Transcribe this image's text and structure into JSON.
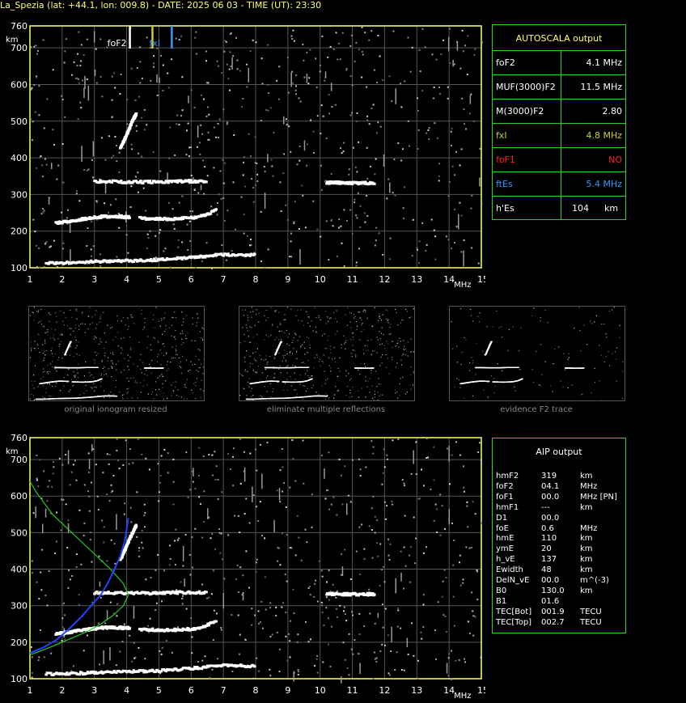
{
  "header": "La_Spezia (lat: +44.1, lon: 009.8) - DATE: 2025 06 03 - TIME (UT): 23:30",
  "colors": {
    "frame": "#ffff66",
    "grid": "#555555",
    "panel_border": "#33cc33",
    "fxI": "#cccc33",
    "foF1": "#ff2020",
    "ftEs": "#3399ff",
    "profile": "#22cc22",
    "trace": "#2244ff"
  },
  "autoscala": {
    "title": "AUTOSCALA output",
    "rows": [
      {
        "label": "foF2",
        "value": "4.1 MHz",
        "color": "#ffffff"
      },
      {
        "label": "MUF(3000)F2",
        "value": "11.5 MHz",
        "color": "#ffffff"
      },
      {
        "label": "M(3000)F2",
        "value": "2.80",
        "color": "#ffffff"
      },
      {
        "label": "fxI",
        "value": "4.8 MHz",
        "color": "#cccc33"
      },
      {
        "label": "foF1",
        "value": "NO",
        "color": "#ff2020"
      },
      {
        "label": "ftEs",
        "value": "5.4 MHz",
        "color": "#3399ff"
      },
      {
        "label": "h'Es",
        "value": "104",
        "unit": "km",
        "color": "#ffffff"
      }
    ]
  },
  "aip": {
    "title": "AIP output",
    "rows": [
      {
        "p": "hmF2",
        "v": "319",
        "u": "km"
      },
      {
        "p": "foF2",
        "v": "04.1",
        "u": "MHz"
      },
      {
        "p": "foF1",
        "v": "00.0",
        "u": "MHz   [PN]"
      },
      {
        "p": "hmF1",
        "v": "---",
        "u": "km"
      },
      {
        "p": "D1",
        "v": "00.0",
        "u": ""
      },
      {
        "p": "foE",
        "v": "0.6",
        "u": "MHz"
      },
      {
        "p": "hmE",
        "v": "110",
        "u": "km"
      },
      {
        "p": "ymE",
        "v": "20",
        "u": "km"
      },
      {
        "p": "h_vE",
        "v": "137",
        "u": "km"
      },
      {
        "p": "Ewidth",
        "v": "48",
        "u": "km"
      },
      {
        "p": "DelN_vE",
        "v": "00.0",
        "u": "m^(-3)"
      },
      {
        "p": "B0",
        "v": "130.0",
        "u": "km"
      },
      {
        "p": "B1",
        "v": "01.6",
        "u": ""
      },
      {
        "p": "TEC[Bot]",
        "v": "001.9",
        "u": "TECU"
      },
      {
        "p": "TEC[Top]",
        "v": "002.7",
        "u": "TECU"
      }
    ]
  },
  "thumb_captions": [
    "original ionogram resized",
    "eliminate multiple reflections",
    "evidence F2 trace"
  ],
  "chart_data": [
    {
      "type": "scatter",
      "xlabel": "MHz",
      "ylabel": "km",
      "xlim": [
        1,
        15
      ],
      "ylim": [
        100,
        760
      ],
      "xticks": [
        "1",
        "2",
        "3",
        "4",
        "5",
        "6",
        "7",
        "8",
        "9",
        "10",
        "11",
        "12",
        "13",
        "14",
        "15"
      ],
      "yticks": [
        "100",
        "200",
        "300",
        "400",
        "500",
        "600",
        "700",
        "760"
      ],
      "grid": true,
      "markers": [
        {
          "label": "foF2",
          "x": 4.1,
          "color": "#ffffff"
        },
        {
          "label": "fxI",
          "x": 4.8,
          "color": "#cccc33"
        },
        {
          "label": "ftEs",
          "x": 5.4,
          "color": "#3399ff"
        }
      ],
      "traces": [
        {
          "name": "Es",
          "x": [
            1.5,
            2,
            2.5,
            3,
            3.5,
            4,
            4.5,
            5,
            5.5,
            6,
            6.5,
            7,
            7.5,
            8
          ],
          "y": [
            113,
            113,
            115,
            117,
            118,
            119,
            120,
            122,
            125,
            128,
            132,
            136,
            136,
            134
          ]
        },
        {
          "name": "F2",
          "x": [
            1.8,
            2.1,
            2.4,
            2.7,
            3,
            3.3,
            3.6,
            3.9,
            4.1
          ],
          "y": [
            222,
            226,
            230,
            234,
            237,
            240,
            240,
            239,
            238
          ]
        },
        {
          "name": "F2_ext",
          "x": [
            4.4,
            4.8,
            5.2,
            5.6,
            6,
            6.4,
            6.8
          ],
          "y": [
            235,
            234,
            233,
            234,
            236,
            243,
            258
          ]
        },
        {
          "name": "F2_2hop",
          "x": [
            3.8,
            3.9,
            4.0,
            4.1,
            4.2,
            4.3
          ],
          "y": [
            425,
            445,
            465,
            485,
            505,
            520
          ]
        },
        {
          "name": "Es_2hop",
          "x": [
            3,
            3.5,
            4,
            4.5,
            5,
            5.5,
            6,
            6.5
          ],
          "y": [
            335,
            335,
            334,
            334,
            334,
            336,
            336,
            336
          ]
        },
        {
          "name": "Es_mult",
          "x": [
            10.2,
            10.5,
            10.8,
            11.1,
            11.4,
            11.7
          ],
          "y": [
            332,
            332,
            331,
            331,
            331,
            332
          ]
        }
      ]
    },
    {
      "type": "scatter",
      "xlabel": "MHz",
      "ylabel": "km",
      "xlim": [
        1,
        15
      ],
      "ylim": [
        100,
        760
      ],
      "xticks": [
        "1",
        "2",
        "3",
        "4",
        "5",
        "6",
        "7",
        "8",
        "9",
        "10",
        "11",
        "12",
        "13",
        "14",
        "15"
      ],
      "yticks": [
        "100",
        "200",
        "300",
        "400",
        "500",
        "600",
        "700",
        "760"
      ],
      "grid": true,
      "series": [
        {
          "name": "profile",
          "kind": "line",
          "x": [
            1.0,
            1.3,
            1.6,
            2.0,
            2.4,
            2.8,
            3.2,
            3.6,
            3.9,
            4.05,
            3.9,
            3.5,
            2.9,
            2.3,
            1.7,
            1.2,
            1.0
          ],
          "y": [
            165,
            175,
            185,
            200,
            215,
            230,
            250,
            275,
            300,
            330,
            360,
            400,
            450,
            500,
            550,
            610,
            640
          ]
        },
        {
          "name": "virtual",
          "kind": "line",
          "x": [
            1.0,
            1.4,
            1.8,
            2.2,
            2.6,
            2.9,
            3.2,
            3.4,
            3.6,
            3.8,
            3.95,
            4.05
          ],
          "y": [
            170,
            185,
            205,
            235,
            270,
            300,
            330,
            360,
            395,
            435,
            480,
            540
          ]
        }
      ]
    }
  ]
}
